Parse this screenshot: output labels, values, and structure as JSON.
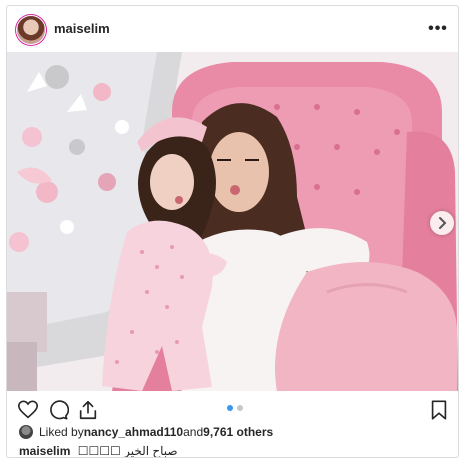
{
  "post": {
    "username": "maiselim",
    "more_label": "•••",
    "likes": {
      "prefix": "Liked by ",
      "liker": "nancy_ahmad110",
      "middle": " and ",
      "others": "9,761 others"
    },
    "caption": {
      "username": "maiselim",
      "text": "صباح الخير ☐☐☐☐"
    },
    "carousel": {
      "total_slides": 2,
      "current_slide": 1
    }
  },
  "icons": {
    "more": "more-options-icon",
    "like": "heart-icon",
    "comment": "comment-icon",
    "share": "share-icon",
    "save": "bookmark-icon",
    "next": "chevron-right-icon"
  },
  "colors": {
    "text": "#262626",
    "border": "#dbdbdb",
    "dot_active": "#3897f0",
    "dot_inactive": "#c7c7c7",
    "chair_pink": "#e98aa7"
  }
}
